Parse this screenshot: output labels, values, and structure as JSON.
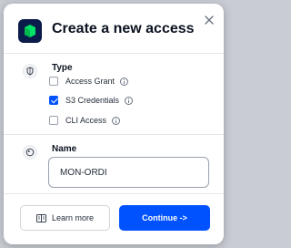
{
  "modal": {
    "title": "Create a new access",
    "logo_icon": "storj-logo",
    "close_icon": "close-icon"
  },
  "type_section": {
    "label": "Type",
    "icon": "shield-icon",
    "options": [
      {
        "label": "Access Grant",
        "checked": false,
        "info_icon": "info-icon"
      },
      {
        "label": "S3 Credentials",
        "checked": true,
        "info_icon": "info-icon"
      },
      {
        "label": "CLI Access",
        "checked": false,
        "info_icon": "info-icon"
      }
    ]
  },
  "name_section": {
    "label": "Name",
    "icon": "badge-icon",
    "value": "MON-ORDI"
  },
  "footer": {
    "learn_more_label": "Learn more",
    "learn_more_icon": "book-icon",
    "continue_label": "Continue ->"
  },
  "colors": {
    "accent": "#0052ff",
    "logo_bg": "#0b1b4a",
    "logo_fg": "#00e366"
  }
}
